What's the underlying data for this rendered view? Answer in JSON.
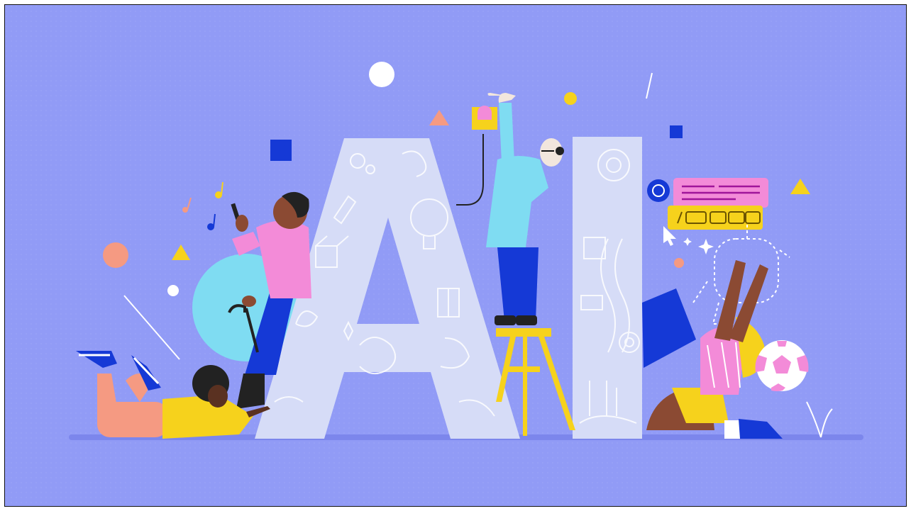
{
  "illustration": {
    "title_letters": "AI",
    "colors": {
      "background": "#919bf6",
      "ground": "#7c86ec",
      "letter_fill": "#d6dcf7",
      "letter_pattern": "#ffffff",
      "yellow": "#f6d21c",
      "pink": "#f38bd8",
      "cyan": "#7fdcf2",
      "blue": "#1539d6",
      "coral": "#f59a82",
      "skin_dark": "#5a3121",
      "skin_brown": "#8b4a33",
      "skin_light": "#f2e6dd"
    },
    "icons": [
      "chat-bubble-icon",
      "music-note-icon",
      "cursor-pointer-icon",
      "sparkle-icon",
      "soccer-ball-icon",
      "robot-outline-icon",
      "button-device-icon"
    ]
  }
}
